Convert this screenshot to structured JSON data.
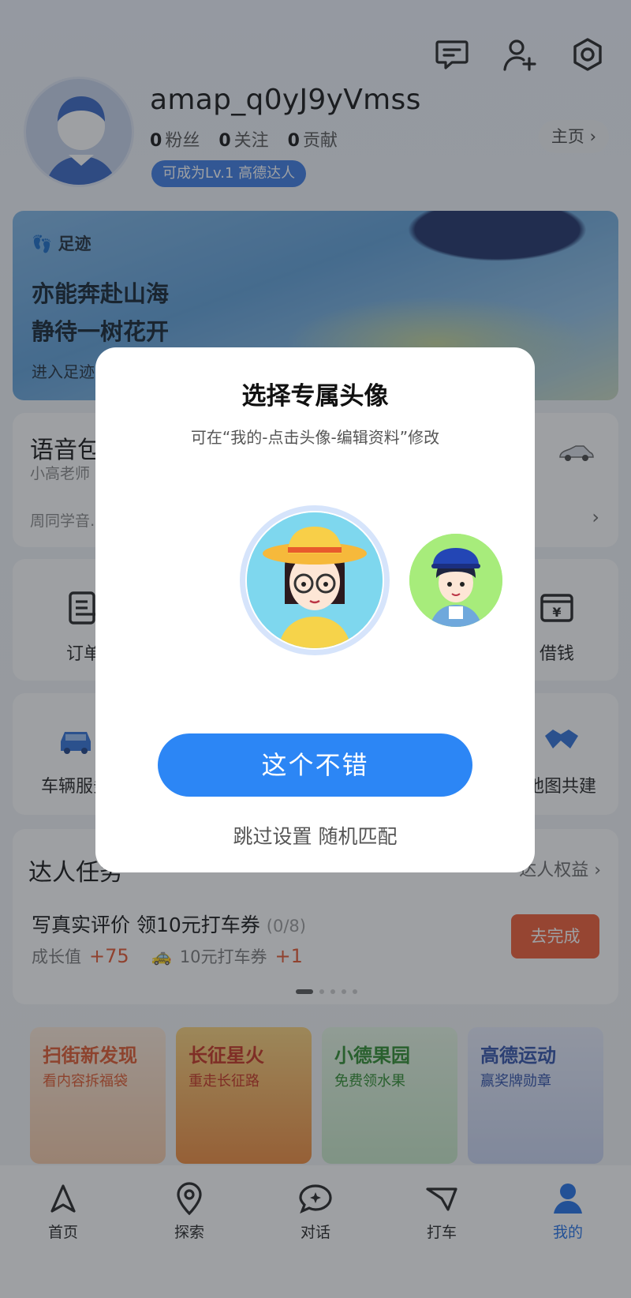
{
  "header": {
    "icons": [
      "message-icon",
      "add-friend-icon",
      "settings-icon"
    ],
    "username": "amap_q0yJ9yVmss",
    "stats": [
      {
        "count": "0",
        "label": "粉丝"
      },
      {
        "count": "0",
        "label": "关注"
      },
      {
        "count": "0",
        "label": "贡献"
      }
    ],
    "level_badge": "可成为Lv.1 高德达人",
    "homepage_link": "主页 ›"
  },
  "banner": {
    "tag": "足迹",
    "line1": "亦能奔赴山海",
    "line2": "静待一树花开",
    "sub": "进入足迹"
  },
  "voice_card": {
    "title": "语音包",
    "sub": "小高老师",
    "foot": "周同学音…"
  },
  "service_grid": {
    "row1": [
      {
        "label": "订单",
        "icon": "order-icon"
      },
      {
        "label": "借钱",
        "icon": "wallet-icon"
      }
    ],
    "row2": [
      {
        "label": "车辆服务",
        "icon": "car-icon"
      },
      {
        "label": "地图共建",
        "icon": "handshake-icon"
      }
    ]
  },
  "tasks": {
    "title": "达人任务",
    "rights_link": "达人权益 ›",
    "task_title": "写真实评价 领10元打车券",
    "progress": "(0/8)",
    "growth_label": "成长值",
    "growth_value": "+75",
    "coupon_label": "10元打车券",
    "coupon_value": "+1",
    "action": "去完成"
  },
  "promos": [
    {
      "title": "扫街新发现",
      "sub": "看内容拆福袋",
      "color": "#f5dcc6",
      "title_color": "#e0572a"
    },
    {
      "title": "长征星火",
      "sub": "重走长征路",
      "color": "#f7b256",
      "title_color": "#c7301d"
    },
    {
      "title": "小德果园",
      "sub": "免费领水果",
      "color": "#dff2dc",
      "title_color": "#2b8a2b"
    },
    {
      "title": "高德运动",
      "sub": "赢奖牌勋章",
      "color": "#dde4f7",
      "title_color": "#2f4fa8"
    }
  ],
  "tabbar": [
    {
      "label": "首页",
      "icon": "navigate-icon"
    },
    {
      "label": "探索",
      "icon": "location-pin-icon"
    },
    {
      "label": "对话",
      "icon": "chat-sparkle-icon"
    },
    {
      "label": "打车",
      "icon": "taxi-flag-icon"
    },
    {
      "label": "我的",
      "icon": "person-icon",
      "active": true
    }
  ],
  "modal": {
    "title": "选择专属头像",
    "hint": "可在“我的-点击头像-编辑资料”修改",
    "confirm": "这个不错",
    "skip": "跳过设置 随机匹配"
  },
  "colors": {
    "accent": "#2c86f5",
    "task_button": "#f05a32",
    "level_badge": "#3b7be3"
  }
}
